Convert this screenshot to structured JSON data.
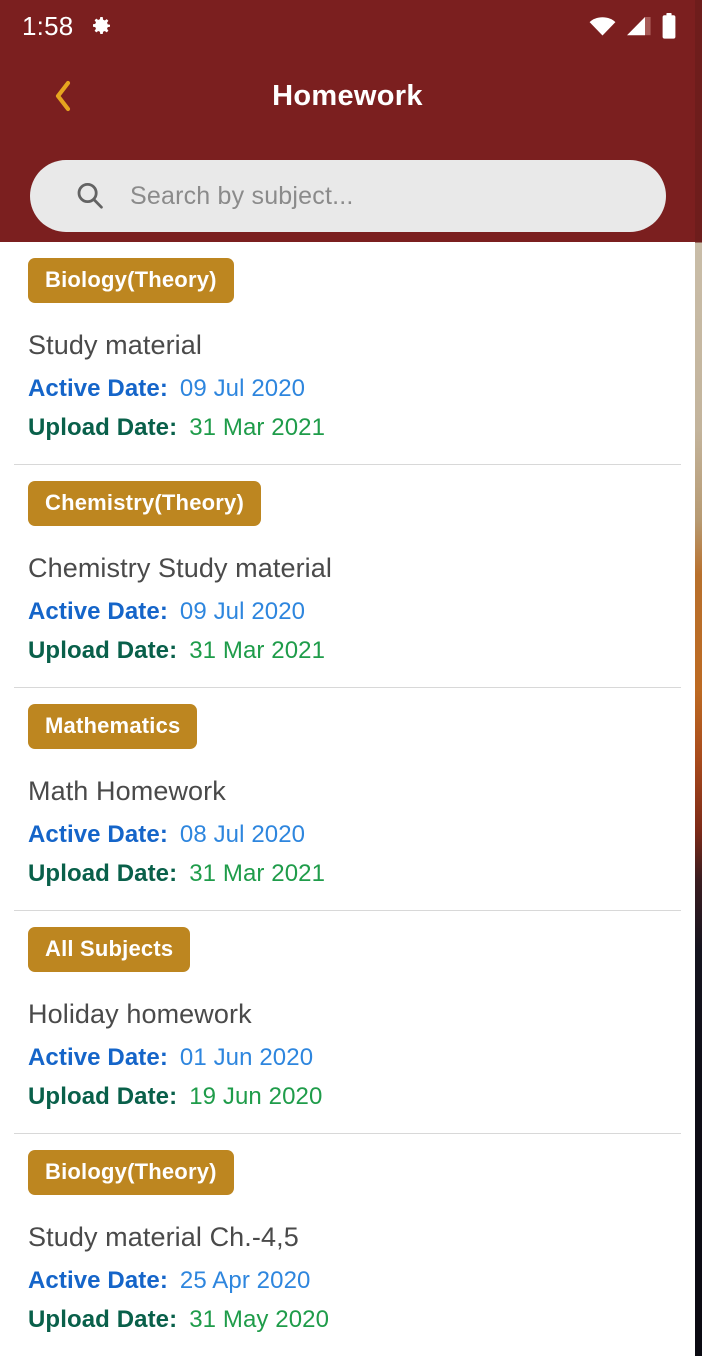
{
  "status_bar": {
    "time": "1:58",
    "icons": [
      "gear-icon",
      "wifi-icon",
      "cellular-signal-icon",
      "battery-icon"
    ]
  },
  "header": {
    "title": "Homework",
    "back_icon": "chevron-left-icon",
    "background_color": "#7b1f1f",
    "accent_color": "#e6a51f"
  },
  "search": {
    "icon": "search-icon",
    "placeholder": "Search by subject...",
    "value": "",
    "background_color": "#e9e9e9"
  },
  "labels": {
    "active_date": "Active Date:",
    "upload_date": "Upload Date:"
  },
  "badge_color": "#bd8620",
  "items": [
    {
      "subject": "Biology(Theory)",
      "title": "Study material",
      "active_date": "09 Jul 2020",
      "upload_date": "31 Mar 2021"
    },
    {
      "subject": "Chemistry(Theory)",
      "title": "Chemistry Study material",
      "active_date": "09 Jul 2020",
      "upload_date": "31 Mar 2021"
    },
    {
      "subject": "Mathematics",
      "title": "Math Homework",
      "active_date": "08 Jul 2020",
      "upload_date": "31 Mar 2021"
    },
    {
      "subject": "All Subjects",
      "title": "Holiday homework",
      "active_date": "01 Jun 2020",
      "upload_date": "19 Jun 2020"
    },
    {
      "subject": "Biology(Theory)",
      "title": "Study material Ch.-4,5",
      "active_date": "25 Apr 2020",
      "upload_date": "31 May 2020"
    }
  ]
}
